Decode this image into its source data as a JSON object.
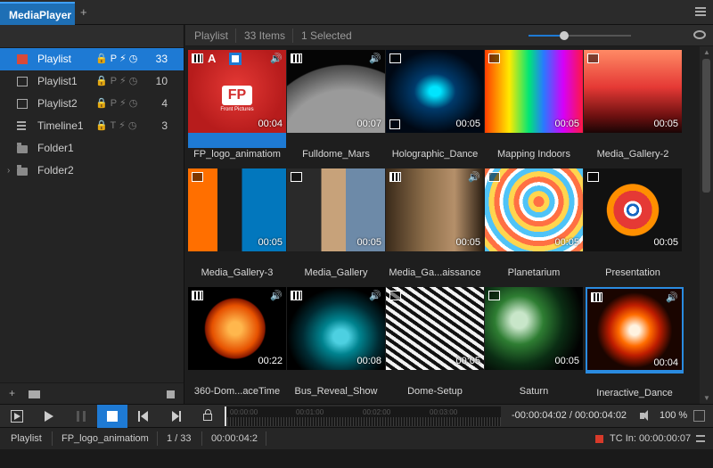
{
  "app": {
    "tab_title": "MediaPlayer",
    "tab_add": "+"
  },
  "sidebar": {
    "items": [
      {
        "label": "Playlist",
        "flags": "🔒 P ⚡ ◷",
        "count": "33",
        "icon": "playlist-icon",
        "active": true
      },
      {
        "label": "Playlist1",
        "flags": "🔒 P ⚡ ◷",
        "count": "10",
        "icon": "list-icon"
      },
      {
        "label": "Playlist2",
        "flags": "🔒 P ⚡ ◷",
        "count": "4",
        "icon": "list-icon"
      },
      {
        "label": "Timeline1",
        "flags": "🔒 T ⚡ ◷",
        "count": "3",
        "icon": "timeline-icon"
      },
      {
        "label": "Folder1",
        "icon": "folder-icon"
      },
      {
        "label": "Folder2",
        "icon": "folder-icon",
        "expand": "›"
      }
    ],
    "footer_add": "+"
  },
  "content_header": {
    "title": "Playlist",
    "items": "33 Items",
    "selected": "1 Selected",
    "thumb_size": 0.35
  },
  "grid": {
    "tiles": [
      {
        "name": "FP_logo_animatiom",
        "duration": "00:04",
        "type": "video",
        "sound": true,
        "selected": true
      },
      {
        "name": "Fulldome_Mars",
        "duration": "00:07",
        "type": "video",
        "sound": true
      },
      {
        "name": "Holographic_Dance",
        "duration": "00:05",
        "type": "image"
      },
      {
        "name": "Mapping Indoors",
        "duration": "00:05",
        "type": "image"
      },
      {
        "name": "Media_Gallery-2",
        "duration": "00:05",
        "type": "image"
      },
      {
        "name": "Media_Gallery-3",
        "duration": "00:05",
        "type": "image"
      },
      {
        "name": "Media_Gallery",
        "duration": "00:05",
        "type": "image"
      },
      {
        "name": "Media_Ga...aissance",
        "duration": "00:05",
        "type": "video",
        "sound": true
      },
      {
        "name": "Planetarium",
        "duration": "00:05",
        "type": "image"
      },
      {
        "name": "Presentation",
        "duration": "00:05",
        "type": "image"
      },
      {
        "name": "360-Dom...aceTime",
        "duration": "00:22",
        "type": "video",
        "sound": true
      },
      {
        "name": "Bus_Reveal_Show",
        "duration": "00:08",
        "type": "video",
        "sound": true
      },
      {
        "name": "Dome-Setup",
        "duration": "00:05",
        "type": "image"
      },
      {
        "name": "Saturn",
        "duration": "00:05",
        "type": "image"
      },
      {
        "name": "Ineractive_Dance",
        "duration": "00:04",
        "type": "video",
        "sound": true,
        "outlined": true
      }
    ],
    "logo_text": "FP",
    "logo_caption": "Front Pictures",
    "badge_letter": "A"
  },
  "transport": {
    "ticks": [
      "00:00:00",
      "00:01:00",
      "00:02:00",
      "00:03:00"
    ],
    "timecode": "-00:00:04:02 / 00:00:04:02",
    "volume": "100 %"
  },
  "statusbar": {
    "playlist": "Playlist",
    "clip": "FP_logo_animatiom",
    "position": "1 / 33",
    "time": "00:00:04:2",
    "tc_label": "TC In:",
    "tc_value": "00:00:00:07"
  },
  "colors": {
    "accent": "#1e7ad4",
    "background": "#1e1e1e",
    "record": "#d83a2a"
  }
}
